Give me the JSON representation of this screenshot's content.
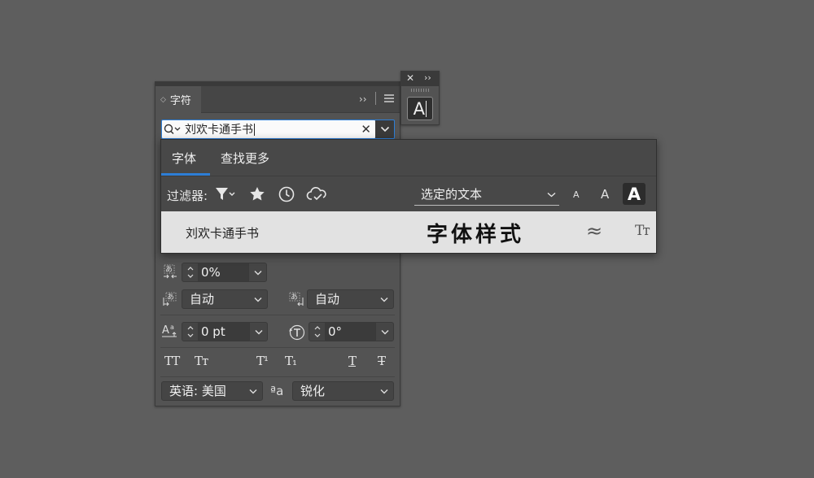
{
  "panel": {
    "tab_label": "字符",
    "search": {
      "value": "刘欢卡通手书"
    },
    "tracking": {
      "value": "0%"
    },
    "leading_left": {
      "value": "自动"
    },
    "leading_right": {
      "value": "自动"
    },
    "baseline": {
      "value": "0 pt"
    },
    "rotation": {
      "value": "0°"
    },
    "type_styles": {
      "all_caps": "TT",
      "small_caps": "Tт",
      "superscript": "T¹",
      "subscript": "T₁",
      "underline": "T",
      "strikethrough": "T"
    },
    "language": {
      "value": "英语: 美国"
    },
    "aa_icon_label": "ªa",
    "antialias": {
      "value": "锐化"
    }
  },
  "glyph_panel": {
    "letter": "A"
  },
  "font_popup": {
    "tabs": [
      {
        "label": "字体",
        "active": true
      },
      {
        "label": "查找更多",
        "active": false
      }
    ],
    "filter_label": "过滤器:",
    "preview_source": "选定的文本",
    "size_small": "A",
    "size_medium": "A",
    "size_large": "A",
    "fonts": [
      {
        "name": "刘欢卡通手书",
        "sample": "字体样式",
        "similar": "≈",
        "type_icon": "Tт"
      }
    ]
  },
  "icons": [
    "search-icon",
    "clear-icon",
    "chevron-down-icon",
    "expand-icon",
    "menu-icon",
    "close-icon",
    "filter-icon",
    "star-icon",
    "clock-icon",
    "cloud-icon",
    "similar-icon",
    "font-type-icon"
  ],
  "colors": {
    "background": "#5e5e5e",
    "panel": "#535353",
    "accent": "#2d7ed6",
    "font_row": "#e2e2e2"
  }
}
